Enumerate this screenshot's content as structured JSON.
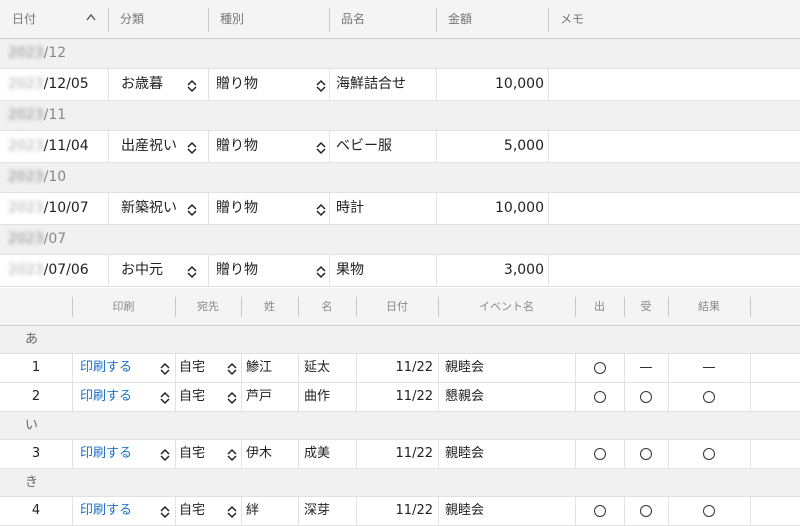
{
  "top_grid": {
    "headers": {
      "date": "日付",
      "category": "分類",
      "kind": "種別",
      "item": "品名",
      "amount": "金額",
      "memo": "メモ"
    },
    "groups": [
      {
        "year": "2023",
        "month": "/12",
        "rows": [
          {
            "year": "2023",
            "date": "/12/05",
            "category": "お歳暮",
            "kind": "贈り物",
            "item": "海鮮詰合せ",
            "amount": "10,000",
            "memo": ""
          }
        ]
      },
      {
        "year": "2023",
        "month": "/11",
        "rows": [
          {
            "year": "2023",
            "date": "/11/04",
            "category": "出産祝い",
            "kind": "贈り物",
            "item": "ベビー服",
            "amount": "5,000",
            "memo": ""
          }
        ]
      },
      {
        "year": "2023",
        "month": "/10",
        "rows": [
          {
            "year": "2023",
            "date": "/10/07",
            "category": "新築祝い",
            "kind": "贈り物",
            "item": "時計",
            "amount": "10,000",
            "memo": ""
          }
        ]
      },
      {
        "year": "2023",
        "month": "/07",
        "rows": [
          {
            "year": "2023",
            "date": "/07/06",
            "category": "お中元",
            "kind": "贈り物",
            "item": "果物",
            "amount": "3,000",
            "memo": ""
          }
        ]
      }
    ]
  },
  "bottom_grid": {
    "headers": {
      "print": "印刷",
      "address": "宛先",
      "last_name": "姓",
      "first_name": "名",
      "date": "日付",
      "event": "イベント名",
      "out": "出",
      "in": "受",
      "result": "結果"
    },
    "groups": [
      {
        "label": "あ",
        "rows": [
          {
            "no": "1",
            "print": "印刷する",
            "address": "自宅",
            "last_name": "鯵江",
            "first_name": "延太",
            "date": "11/22",
            "event": "親睦会",
            "out": "circle",
            "in": "dash",
            "result": "dash"
          },
          {
            "no": "2",
            "print": "印刷する",
            "address": "自宅",
            "last_name": "芦戸",
            "first_name": "曲作",
            "date": "11/22",
            "event": "懇親会",
            "out": "circle",
            "in": "circle",
            "result": "circle"
          }
        ]
      },
      {
        "label": "い",
        "rows": [
          {
            "no": "3",
            "print": "印刷する",
            "address": "自宅",
            "last_name": "伊木",
            "first_name": "成美",
            "date": "11/22",
            "event": "親睦会",
            "out": "circle",
            "in": "circle",
            "result": "circle"
          }
        ]
      },
      {
        "label": "き",
        "rows": [
          {
            "no": "4",
            "print": "印刷する",
            "address": "自宅",
            "last_name": "絆",
            "first_name": "深芽",
            "date": "11/22",
            "event": "親睦会",
            "out": "circle",
            "in": "circle",
            "result": "circle"
          }
        ]
      }
    ]
  }
}
